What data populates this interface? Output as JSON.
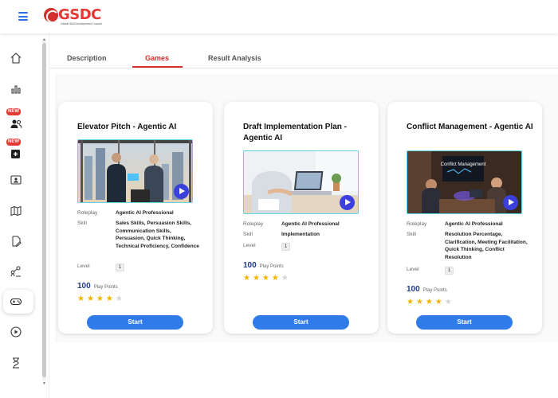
{
  "header": {
    "logo_text": "GSDC",
    "logo_subtitle": "Global Skill Development Council"
  },
  "sidebar": {
    "items": [
      {
        "icon": "home-icon"
      },
      {
        "icon": "bar-chart-icon"
      },
      {
        "icon": "users-icon",
        "badge": "NEW"
      },
      {
        "icon": "add-content-icon",
        "badge": "NEW"
      },
      {
        "icon": "id-card-icon"
      },
      {
        "icon": "map-icon"
      },
      {
        "icon": "edit-document-icon"
      },
      {
        "icon": "network-icon"
      },
      {
        "icon": "gamepad-icon",
        "active": true
      },
      {
        "icon": "play-circle-icon"
      },
      {
        "icon": "hourglass-icon"
      }
    ]
  },
  "tabs": [
    {
      "label": "Description",
      "active": false
    },
    {
      "label": "Games",
      "active": true
    },
    {
      "label": "Result Analysis",
      "active": false
    }
  ],
  "labels": {
    "roleplay": "Roleplay",
    "skill": "Skill",
    "level": "Level",
    "points_unit": "Play Points",
    "start": "Start"
  },
  "cards": [
    {
      "title": "Elevator Pitch - Agentic AI",
      "roleplay": "Agentic AI Professional",
      "skill": "Sales Skills, Persuasion Skills, Communication Skills, Persuasion, Quick Thinking, Technical Proficiency, Confidence",
      "level": "1",
      "points": "100",
      "rating": 4,
      "rating_max": 5
    },
    {
      "title": "Draft Implementation Plan - Agentic AI",
      "roleplay": "Agentic AI Professional",
      "skill": "Implementation",
      "level": "1",
      "points": "100",
      "rating": 4,
      "rating_max": 5
    },
    {
      "title": "Conflict Management - Agentic AI",
      "roleplay": "Agentic AI Professional",
      "skill": "Resolution Percentage, Clarification, Meeting Facilitation, Quick Thinking, Conflict Resolution",
      "level": "1",
      "points": "100",
      "rating": 4,
      "rating_max": 5,
      "thumbnail_text": "Conflict Management"
    }
  ],
  "colors": {
    "accent_red": "#d32f2f",
    "button_blue": "#2f7bea",
    "star": "#f5b301",
    "points": "#1e3a8a"
  }
}
